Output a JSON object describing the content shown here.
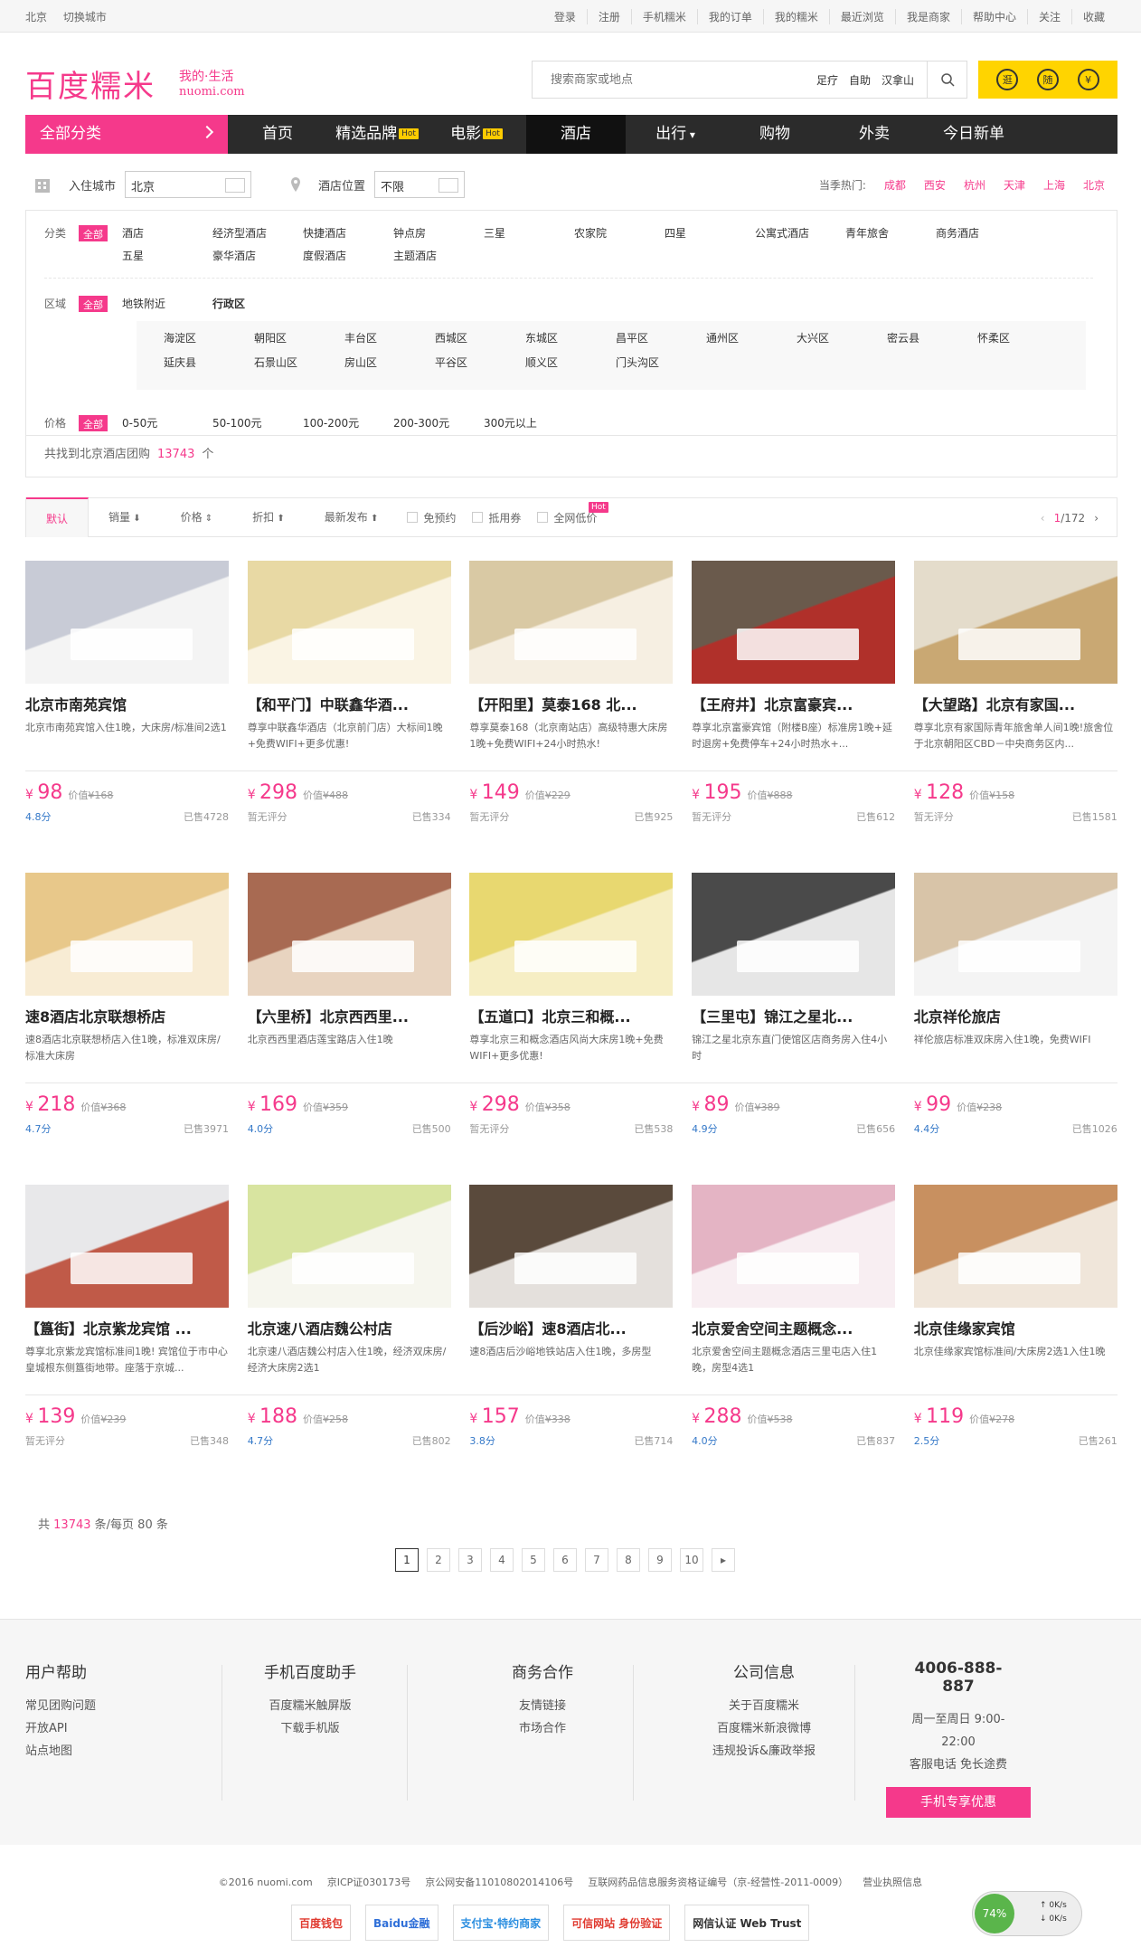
{
  "topbar": {
    "city": "北京",
    "switch_city": "切换城市",
    "links": [
      "登录",
      "注册",
      "手机糯米",
      "我的订单",
      "我的糯米",
      "最近浏览",
      "我是商家",
      "帮助中心",
      "关注",
      "收藏"
    ]
  },
  "logo": {
    "main": "百度糯米",
    "tag1": "我的·生活",
    "tag2": "nuomi.com"
  },
  "search": {
    "placeholder": "搜索商家或地点",
    "tags": [
      "足疗",
      "自助",
      "汉拿山"
    ]
  },
  "promo_icons": [
    "逛",
    "随",
    "¥"
  ],
  "nav": {
    "all": "全部分类",
    "items": [
      {
        "label": "首页"
      },
      {
        "label": "精选品牌",
        "hot": "Hot"
      },
      {
        "label": "电影",
        "hot": "Hot"
      },
      {
        "label": "酒店"
      },
      {
        "label": "出行"
      },
      {
        "label": "购物"
      },
      {
        "label": "外卖"
      },
      {
        "label": "今日新单"
      }
    ]
  },
  "filterbar": {
    "city_label": "入住城市",
    "city_value": "北京",
    "loc_label": "酒店位置",
    "loc_value": "不限",
    "hot_label": "当季热门:",
    "hot_cities": [
      "成都",
      "西安",
      "杭州",
      "天津",
      "上海",
      "北京"
    ]
  },
  "filters": {
    "category_label": "分类",
    "all": "全部",
    "categories": [
      "酒店",
      "经济型酒店",
      "快捷酒店",
      "钟点房",
      "三星",
      "农家院",
      "四星",
      "公寓式酒店",
      "青年旅舍",
      "商务酒店",
      "五星",
      "豪华酒店",
      "度假酒店",
      "主题酒店"
    ],
    "area_label": "区域",
    "area_tabs": [
      "地铁附近",
      "行政区"
    ],
    "districts": [
      "海淀区",
      "朝阳区",
      "丰台区",
      "西城区",
      "东城区",
      "昌平区",
      "通州区",
      "大兴区",
      "密云县",
      "怀柔区",
      "延庆县",
      "石景山区",
      "房山区",
      "平谷区",
      "顺义区",
      "门头沟区"
    ],
    "price_label": "价格",
    "prices": [
      "0-50元",
      "50-100元",
      "100-200元",
      "200-300元",
      "300元以上"
    ],
    "count_prefix": "共找到北京酒店团购",
    "count": "13743",
    "count_suffix": "个"
  },
  "sortbar": {
    "items": [
      "默认",
      "销量",
      "价格",
      "折扣",
      "最新发布"
    ],
    "checks": [
      "免预约",
      "抵用券",
      "全网低价"
    ],
    "hot": "Hot",
    "page": "1",
    "page_total": "/172"
  },
  "hotels": [
    {
      "title": "北京市南苑宾馆",
      "desc": "北京市南苑宾馆入住1晚，大床房/标准间2选1",
      "price": "98",
      "old": "¥168",
      "rating": "4.8分",
      "sold": "已售4728",
      "c1": "#c8cbd6",
      "c2": "#f4f4f4"
    },
    {
      "title": "【和平门】中联鑫华酒...",
      "desc": "尊享中联鑫华酒店（北京前门店）大标间1晚+免费WIFI+更多优惠!",
      "price": "298",
      "old": "¥488",
      "rating": "暂无评分",
      "sold": "已售334",
      "c1": "#e8d9a4",
      "c2": "#faf4e4"
    },
    {
      "title": "【开阳里】莫泰168 北...",
      "desc": "尊享莫泰168（北京南站店）高级特惠大床房1晚+免费WIFI+24小时热水!",
      "price": "149",
      "old": "¥229",
      "rating": "暂无评分",
      "sold": "已售925",
      "c1": "#d9c9a4",
      "c2": "#f6efe2"
    },
    {
      "title": "【王府井】北京富豪宾...",
      "desc": "尊享北京富豪宾馆（附楼B座）标准房1晚+延时退房+免费停车+24小时热水+...",
      "price": "195",
      "old": "¥888",
      "rating": "暂无评分",
      "sold": "已售612",
      "c1": "#6a5a4c",
      "c2": "#b0302a"
    },
    {
      "title": "【大望路】北京有家国...",
      "desc": "尊享北京有家国际青年旅舍单人间1晚!旅舍位于北京朝阳区CBD－中央商务区内...",
      "price": "128",
      "old": "¥158",
      "rating": "暂无评分",
      "sold": "已售1581",
      "c1": "#e4dccb",
      "c2": "#c9a873"
    },
    {
      "title": "速8酒店北京联想桥店",
      "desc": "速8酒店北京联想桥店入住1晚，标准双床房/标准大床房",
      "price": "218",
      "old": "¥368",
      "rating": "4.7分",
      "sold": "已售3971",
      "c1": "#e8c88a",
      "c2": "#f8ecd4"
    },
    {
      "title": "【六里桥】北京西西里...",
      "desc": "北京西西里酒店莲宝路店入住1晚",
      "price": "169",
      "old": "¥359",
      "rating": "4.0分",
      "sold": "已售500",
      "c1": "#a86a52",
      "c2": "#e8d4c0"
    },
    {
      "title": "【五道口】北京三和概...",
      "desc": "尊享北京三和概念酒店风尚大床房1晚+免费WIFI+更多优惠!",
      "price": "298",
      "old": "¥358",
      "rating": "暂无评分",
      "sold": "已售538",
      "c1": "#e8d870",
      "c2": "#f6eec4"
    },
    {
      "title": "【三里屯】锦江之星北...",
      "desc": "锦江之星北京东直门使馆区店商务房入住4小时",
      "price": "89",
      "old": "¥389",
      "rating": "4.9分",
      "sold": "已售656",
      "c1": "#4a4a4a",
      "c2": "#e6e6e6"
    },
    {
      "title": "北京祥伦旅店",
      "desc": "祥伦旅店标准双床房入住1晚，免费WIFI",
      "price": "99",
      "old": "¥238",
      "rating": "4.4分",
      "sold": "已售1026",
      "c1": "#d8c4a8",
      "c2": "#f4f4f4"
    },
    {
      "title": "【簋街】北京紫龙宾馆 ...",
      "desc": "尊享北京紫龙宾馆标准间1晚! 宾馆位于市中心皇城根东侧簋街地带。座落于京城...",
      "price": "139",
      "old": "¥239",
      "rating": "暂无评分",
      "sold": "已售348",
      "c1": "#e8e8ea",
      "c2": "#c05a48"
    },
    {
      "title": "北京速八酒店魏公村店",
      "desc": "北京速八酒店魏公村店入住1晚，经济双床房/经济大床房2选1",
      "price": "188",
      "old": "¥258",
      "rating": "4.7分",
      "sold": "已售802",
      "c1": "#d8e4a0",
      "c2": "#f6f6ee"
    },
    {
      "title": "【后沙峪】速8酒店北...",
      "desc": "速8酒店后沙峪地铁站店入住1晚，多房型",
      "price": "157",
      "old": "¥338",
      "rating": "3.8分",
      "sold": "已售714",
      "c1": "#5a4a3c",
      "c2": "#e4e0dc"
    },
    {
      "title": "北京爱舍空间主题概念...",
      "desc": "北京爱舍空间主题概念酒店三里屯店入住1晚，房型4选1",
      "price": "288",
      "old": "¥538",
      "rating": "4.0分",
      "sold": "已售837",
      "c1": "#e4b4c4",
      "c2": "#f8eef2"
    },
    {
      "title": "北京佳缘家宾馆",
      "desc": "北京佳缘家宾馆标准间/大床房2选1入住1晚",
      "price": "119",
      "old": "¥278",
      "rating": "2.5分",
      "sold": "已售261",
      "c1": "#c89060",
      "c2": "#f0e6da"
    }
  ],
  "pagination": {
    "total_prefix": "共",
    "total": "13743",
    "total_suffix": "条/每页 80 条",
    "pages": [
      "1",
      "2",
      "3",
      "4",
      "5",
      "6",
      "7",
      "8",
      "9",
      "10",
      "▸"
    ]
  },
  "footer": {
    "cols": [
      {
        "title": "用户帮助",
        "links": [
          "常见团购问题",
          "开放API",
          "站点地图"
        ]
      },
      {
        "title": "手机百度助手",
        "links": [
          "百度糯米触屏版",
          "下载手机版"
        ]
      },
      {
        "title": "商务合作",
        "links": [
          "友情链接",
          "市场合作"
        ]
      },
      {
        "title": "公司信息",
        "links": [
          "关于百度糯米",
          "百度糯米新浪微博",
          "违规投诉&廉政举报"
        ]
      }
    ],
    "phone": "4006-888-887",
    "hours": "周一至周日 9:00-22:00",
    "service": "客服电话 免长途费",
    "mobile_btn": "手机专享优惠"
  },
  "copyright": [
    "©2016  nuomi.com",
    "京ICP证030173号",
    "京公网安备11010802014106号",
    "互联网药品信息服务资格证编号（京-经营性-2011-0009）",
    "营业执照信息"
  ],
  "badges": [
    "百度钱包",
    "Baidu金融",
    "支付宝·特约商家",
    "可信网站 身份验证",
    "网信认证 Web Trust"
  ],
  "speed": {
    "pct": "74%",
    "up": "0K/s",
    "down": "0K/s"
  }
}
